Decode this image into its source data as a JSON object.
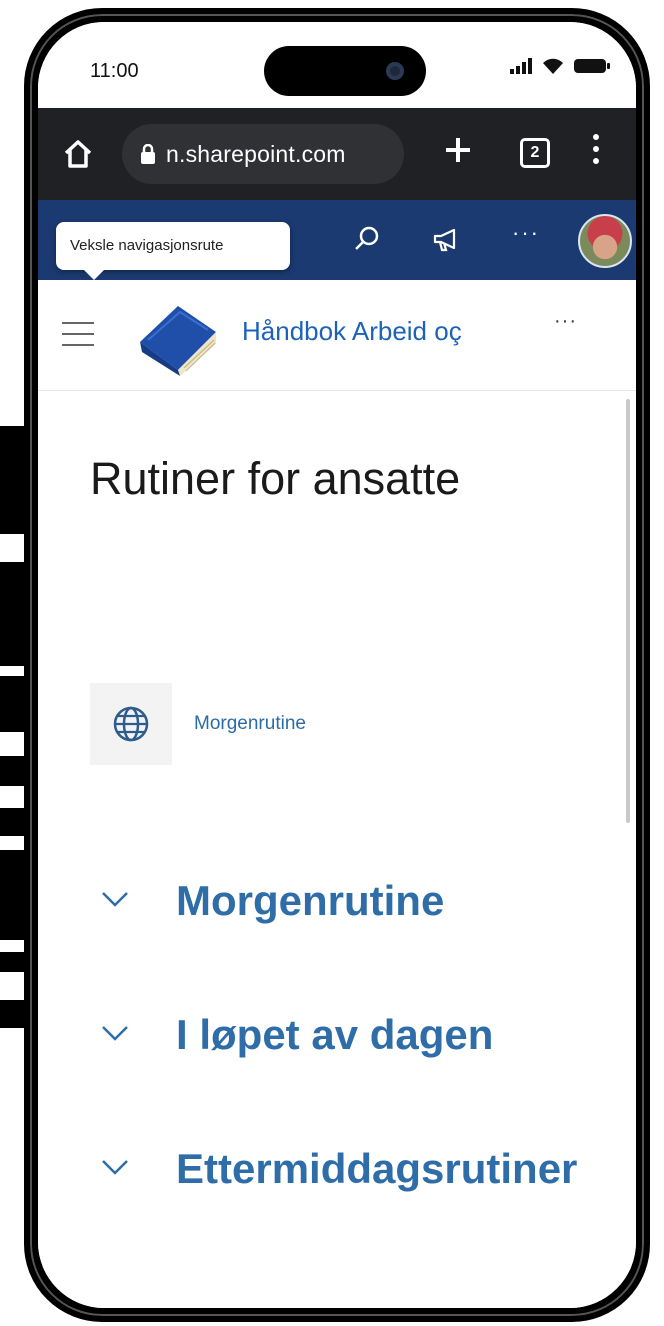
{
  "status_bar": {
    "time": "11:00"
  },
  "browser": {
    "url": "n.sharepoint.com",
    "tab_count": "2"
  },
  "suite_bar": {
    "tooltip": "Veksle navigasjonsrute",
    "more_label": "···"
  },
  "site_header": {
    "title": "Håndbok Arbeid oç",
    "more_label": "···"
  },
  "page": {
    "title": "Rutiner for ansatte",
    "quick_link": {
      "label": "Morgenrutine",
      "icon": "globe-icon"
    },
    "sections": [
      {
        "title": "Morgenrutine"
      },
      {
        "title": "I løpet av dagen"
      },
      {
        "title": "Ettermiddagsrutiner"
      }
    ]
  },
  "colors": {
    "suite_bar": "#1b3a71",
    "browser_bar": "#202124",
    "link_blue": "#2f6da8",
    "site_title_blue": "#1c62b9"
  }
}
